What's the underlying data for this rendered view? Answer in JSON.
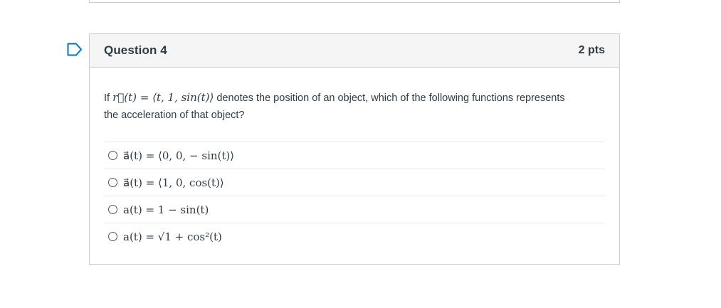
{
  "question": {
    "title": "Question 4",
    "points": "2 pts",
    "prompt_before": "If ",
    "prompt_math": "r⃗(t) = ⟨t, 1, sin(t)⟩",
    "prompt_after": " denotes the position of an object, which of the following functions represents the acceleration of that object?"
  },
  "answers": [
    {
      "text": "a⃗(t) = ⟨0, 0, − sin(t)⟩"
    },
    {
      "text": "a⃗(t) = ⟨1, 0, cos(t)⟩"
    },
    {
      "text": "a(t) = 1 − sin(t)"
    },
    {
      "text": "a(t) = √1 + cos²(t)"
    }
  ],
  "colors": {
    "border": "#c7cdd1",
    "header_bg": "#f5f5f5",
    "text": "#2d3b45",
    "flag": "#0374b5"
  },
  "icons": {
    "flag": "bookmark-flag-icon"
  }
}
